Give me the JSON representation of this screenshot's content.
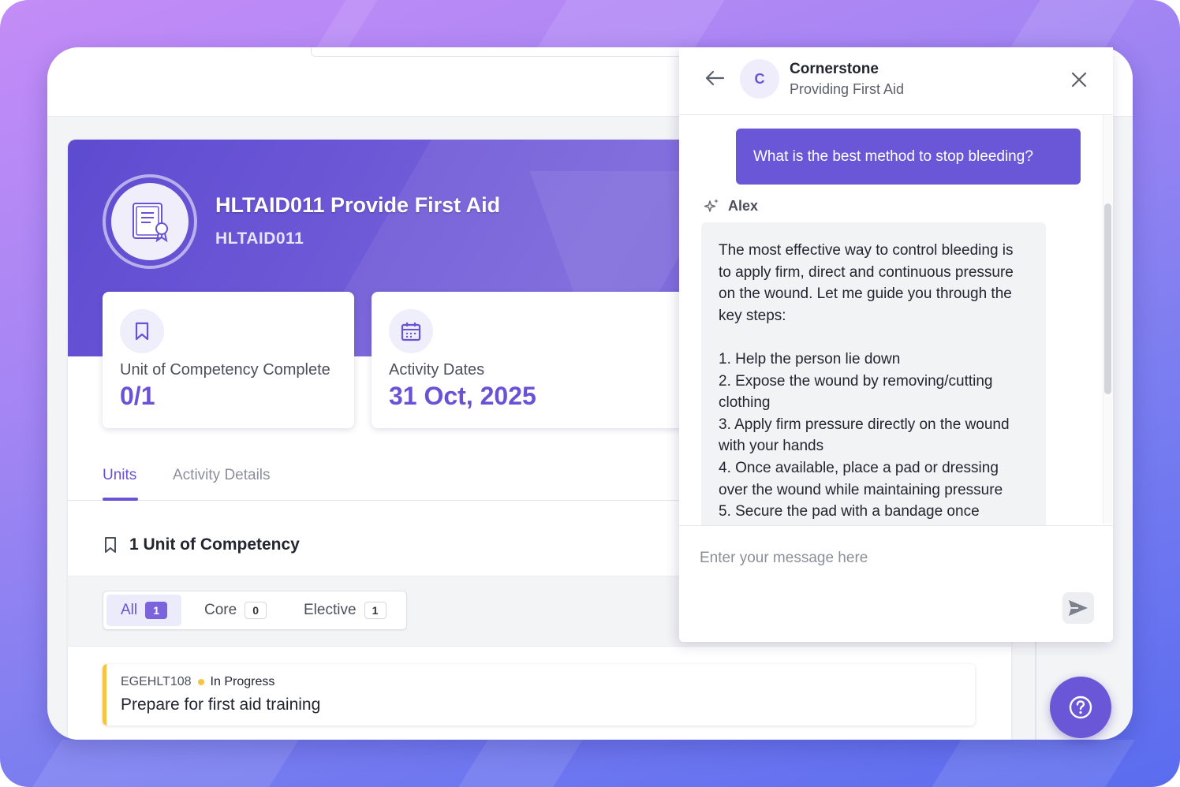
{
  "course": {
    "title": "HLTAID011 Provide First Aid",
    "code": "HLTAID011"
  },
  "stats": [
    {
      "icon": "bookmark-icon",
      "label": "Unit of Competency Complete",
      "value": "0/1"
    },
    {
      "icon": "calendar-icon",
      "label": "Activity Dates",
      "value": "31 Oct, 2025"
    }
  ],
  "tabs": [
    {
      "label": "Units",
      "active": true
    },
    {
      "label": "Activity Details",
      "active": false
    }
  ],
  "units_section": {
    "heading": "1 Unit of Competency",
    "filters": [
      {
        "label": "All",
        "count": "1",
        "active": true
      },
      {
        "label": "Core",
        "count": "0",
        "active": false
      },
      {
        "label": "Elective",
        "count": "1",
        "active": false
      }
    ],
    "units": [
      {
        "code": "EGEHLT108",
        "status": "In Progress",
        "title": "Prepare for first aid training",
        "status_color": "#f5c443"
      }
    ]
  },
  "chat": {
    "avatar_initial": "C",
    "name": "Cornerstone",
    "subtitle": "Providing First Aid",
    "user_message": "What is the best method to stop bleeding?",
    "assistant_name": "Alex",
    "assistant_message": "The most effective way to control bleeding is to apply firm, direct and continuous pressure on the wound. Let me guide you through the key steps:\n\n1. Help the person lie down\n2. Expose the wound by removing/cutting clothing\n3. Apply firm pressure directly on the wound with your hands\n4. Once available, place a pad or dressing over the wound while maintaining pressure\n5. Secure the pad with a bandage once",
    "input_placeholder": "Enter your message here"
  },
  "colors": {
    "accent": "#6a52d6",
    "hero_gradient_start": "#5d4bd0",
    "in_progress": "#f5c443"
  }
}
